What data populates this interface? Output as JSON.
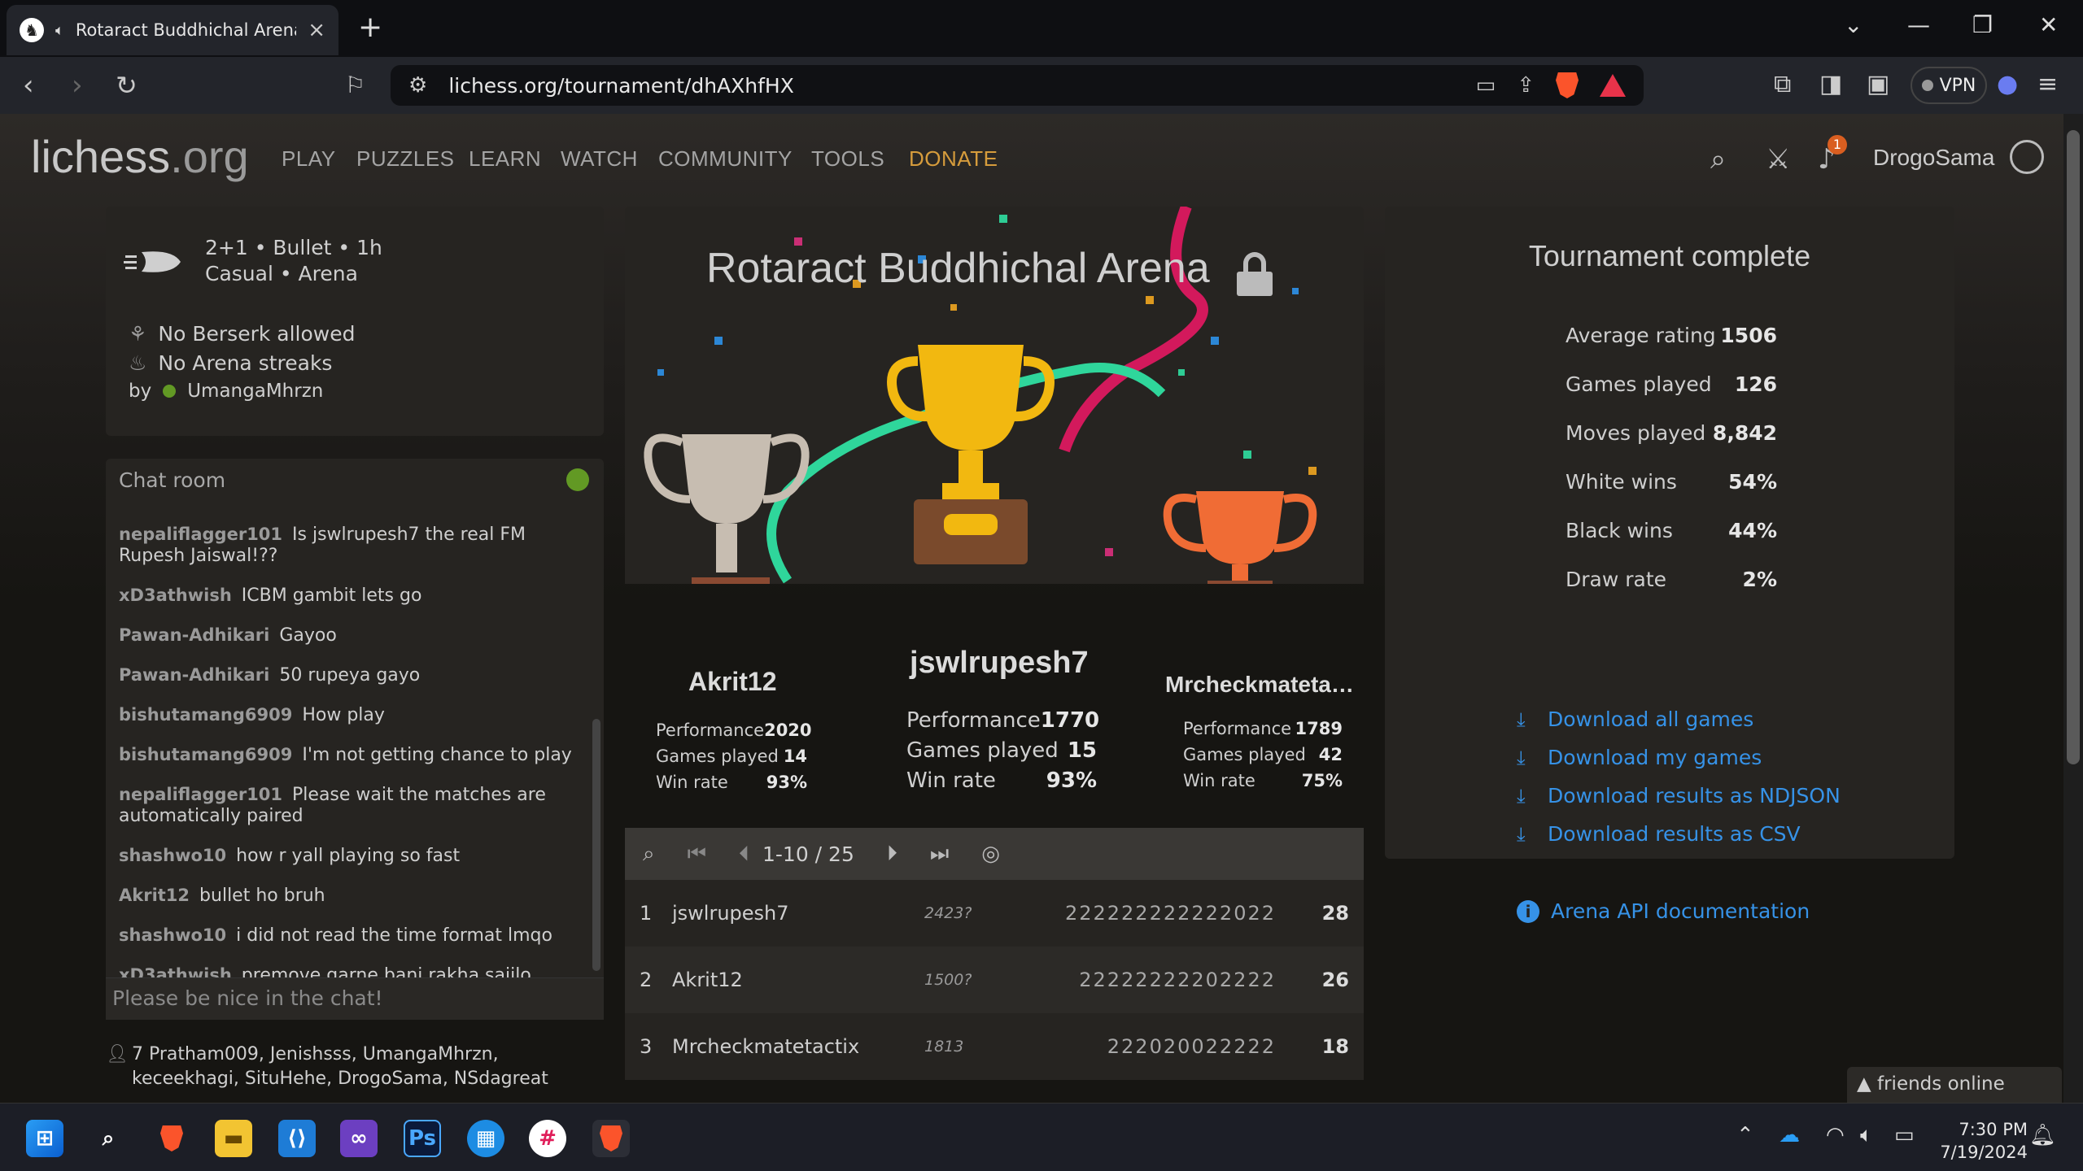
{
  "browser": {
    "tab_title": "Rotaract Buddhichal Arena #dhAXhfHX",
    "url": "lichess.org/tournament/dhAXhfHX",
    "vpn_label": "VPN"
  },
  "site": {
    "logo_main": "lichess",
    "logo_tld": ".org",
    "nav": [
      "PLAY",
      "PUZZLES",
      "LEARN",
      "WATCH",
      "COMMUNITY",
      "TOOLS",
      "DONATE"
    ],
    "notification_count": "1",
    "username": "DrogoSama"
  },
  "tournament_info": {
    "line1": "2+1 • Bullet • 1h",
    "line2": "Casual • Arena",
    "rule1": "No Berserk allowed",
    "rule2": "No Arena streaks",
    "by_label": "by",
    "creator": "UmangaMhrzn"
  },
  "chat": {
    "title": "Chat room",
    "messages": [
      {
        "user": "nepaliflagger101",
        "text": "Is jswlrupesh7 the real FM Rupesh Jaiswal!??"
      },
      {
        "user": "xD3athwish",
        "text": "ICBM gambit lets go"
      },
      {
        "user": "Pawan-Adhikari",
        "text": "Gayoo"
      },
      {
        "user": "Pawan-Adhikari",
        "text": "50 rupeya gayo"
      },
      {
        "user": "bishutamang6909",
        "text": "How play"
      },
      {
        "user": "bishutamang6909",
        "text": "I'm not getting chance to play"
      },
      {
        "user": "nepaliflagger101",
        "text": "Please wait the matches are automatically paired"
      },
      {
        "user": "shashwo10",
        "text": "how r yall playing so fast"
      },
      {
        "user": "Akrit12",
        "text": "bullet ho bruh"
      },
      {
        "user": "shashwo10",
        "text": "i did not read the time format lmqo"
      },
      {
        "user": "xD3athwish",
        "text": "premove garne bani rakha sajilo huncha"
      }
    ],
    "input_placeholder": "Please be nice in the chat!"
  },
  "spectators": {
    "count": "7",
    "names": "Pratham009, Jenishsss, UmangaMhrzn, keceekhagi, SituHehe, DrogoSama, NSdagreat"
  },
  "podium": {
    "title": "Rotaract Buddhichal Arena",
    "performance_label": "Performance",
    "games_label": "Games played",
    "winrate_label": "Win rate",
    "first": {
      "name": "jswlrupesh7",
      "performance": "1770",
      "games": "15",
      "winrate": "93%"
    },
    "second": {
      "name": "Akrit12",
      "performance": "2020",
      "games": "14",
      "winrate": "93%"
    },
    "third": {
      "name": "Mrcheckmateta…",
      "performance": "1789",
      "games": "42",
      "winrate": "75%"
    }
  },
  "pager": {
    "text": "1-10 / 25"
  },
  "standings": [
    {
      "rank": "1",
      "name": "jswlrupesh7",
      "rating": "2423?",
      "sheet": "222222222222022",
      "total": "28"
    },
    {
      "rank": "2",
      "name": "Akrit12",
      "rating": "1500?",
      "sheet": "22222222202222",
      "total": "26"
    },
    {
      "rank": "3",
      "name": "Mrcheckmatetactix",
      "rating": "1813",
      "sheet": "222020022222",
      "total": "18"
    }
  ],
  "complete": {
    "title": "Tournament complete",
    "stats": [
      {
        "label": "Average rating",
        "value": "1506"
      },
      {
        "label": "Games played",
        "value": "126"
      },
      {
        "label": "Moves played",
        "value": "8,842"
      },
      {
        "label": "White wins",
        "value": "54%"
      },
      {
        "label": "Black wins",
        "value": "44%"
      },
      {
        "label": "Draw rate",
        "value": "2%"
      }
    ],
    "downloads": [
      "Download all games",
      "Download my games",
      "Download results as NDJSON",
      "Download results as CSV"
    ],
    "api": "Arena API documentation"
  },
  "friends": {
    "label": "friends online"
  },
  "taskbar": {
    "time": "7:30 PM",
    "date": "7/19/2024"
  },
  "colors": {
    "accent_blue": "#3692e7",
    "donate": "#d69c3c",
    "online_green": "#629924",
    "background": "#161512"
  }
}
